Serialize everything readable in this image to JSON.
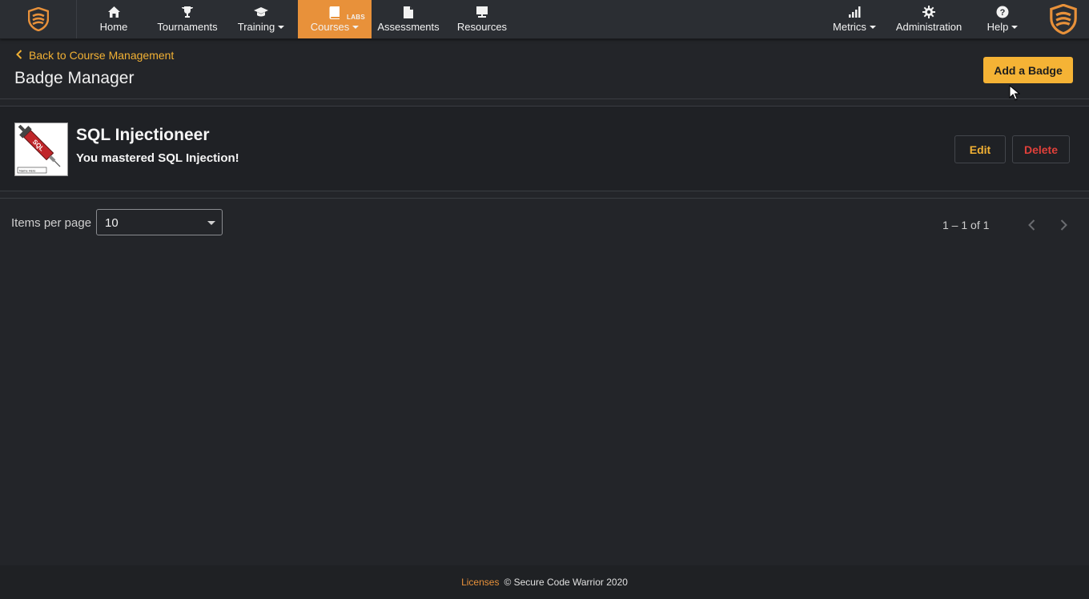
{
  "nav": {
    "items": [
      {
        "label": "Home",
        "icon": "home-icon"
      },
      {
        "label": "Tournaments",
        "icon": "trophy-icon"
      },
      {
        "label": "Training",
        "icon": "graduation-cap-icon"
      },
      {
        "label": "Courses",
        "icon": "book-icon",
        "tag": "LABS",
        "active": true
      },
      {
        "label": "Assessments",
        "icon": "document-icon"
      },
      {
        "label": "Resources",
        "icon": "presentation-icon"
      },
      {
        "label": "Metrics",
        "icon": "bar-chart-icon"
      },
      {
        "label": "Administration",
        "icon": "gear-icon"
      },
      {
        "label": "Help",
        "icon": "help-circle-icon"
      }
    ],
    "accent": "#e8913a"
  },
  "header": {
    "back_label": "Back to Course Management",
    "title": "Badge Manager",
    "add_label": "Add a Badge"
  },
  "badges": [
    {
      "name": "SQL Injectioneer",
      "description": "You mastered SQL Injection!",
      "image_text": "SQL",
      "image_caption": "Name Here",
      "edit_label": "Edit",
      "delete_label": "Delete"
    }
  ],
  "pagination": {
    "items_per_page_label": "Items per page",
    "items_per_page": "10",
    "range": "1 – 1 of 1"
  },
  "footer": {
    "licenses": "Licenses",
    "copyright": "© Secure Code Warrior 2020"
  },
  "colors": {
    "accent_yellow": "#f5b335",
    "delete_red": "#e0403a",
    "background": "#232529"
  }
}
